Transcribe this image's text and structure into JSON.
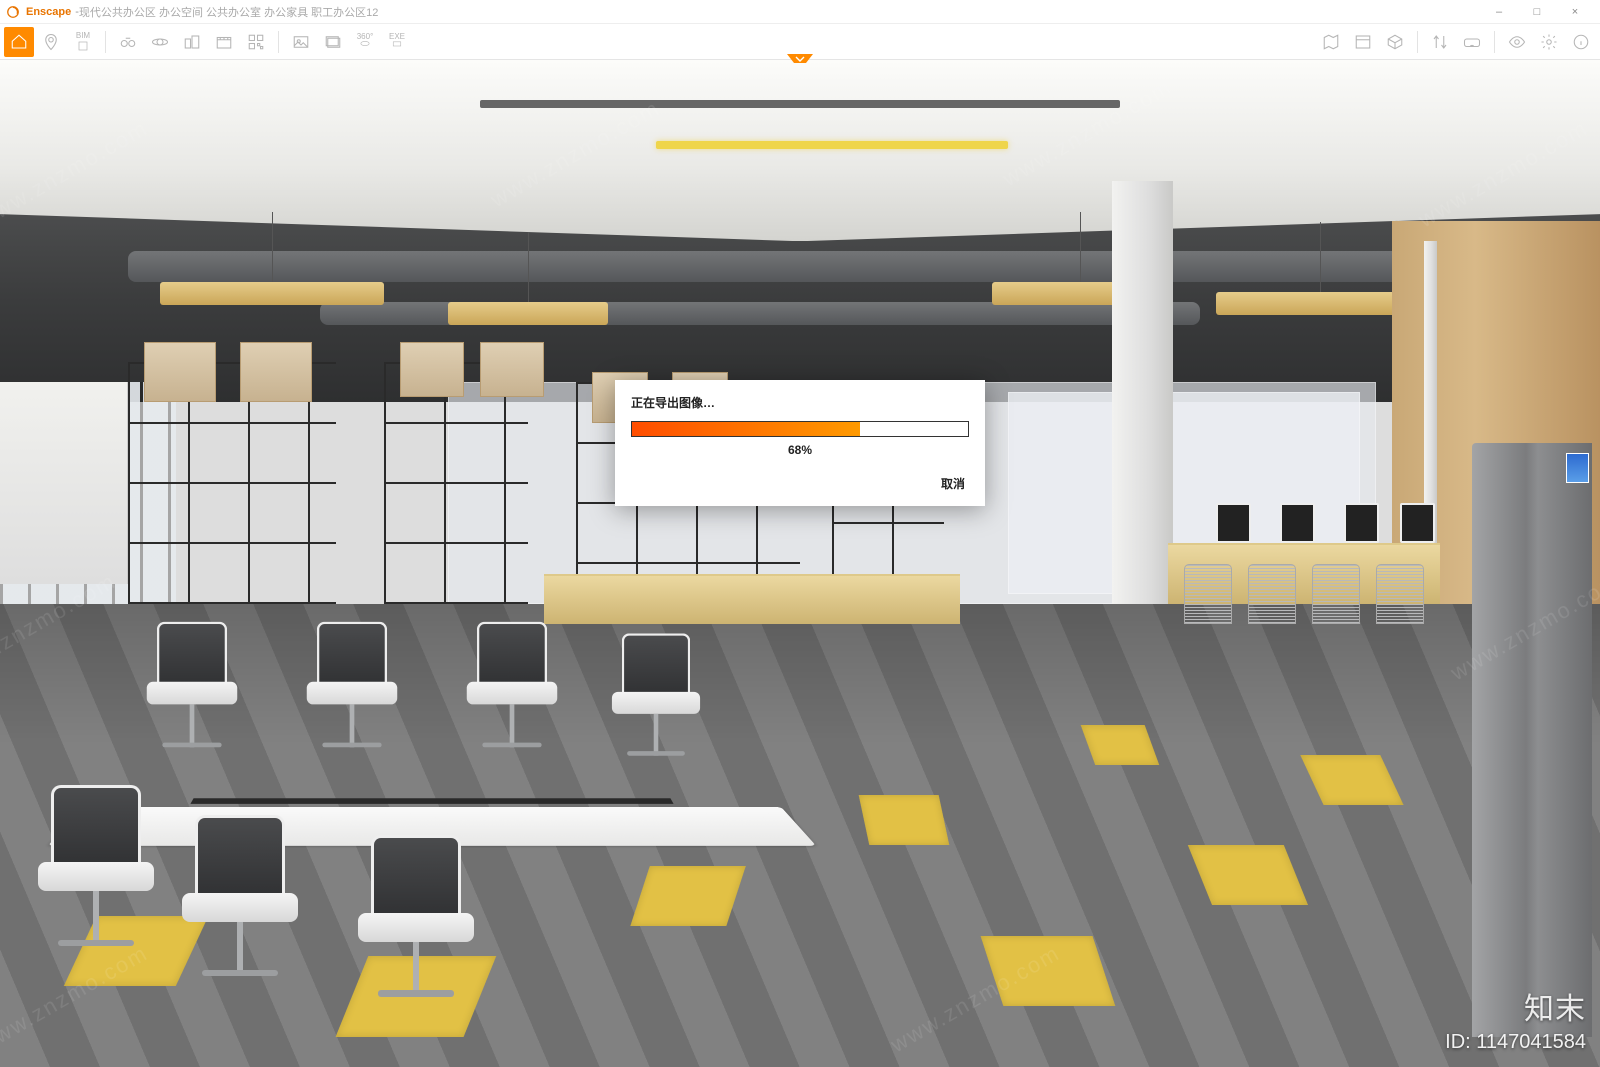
{
  "app": {
    "name": "Enscape",
    "document_title": "现代公共办公区 办公空间 公共办公室 办公家具 职工办公区12"
  },
  "window_controls": {
    "minimize": "–",
    "maximize": "□",
    "close": "×"
  },
  "toolbar_left": [
    {
      "name": "home",
      "active": true
    },
    {
      "name": "map-pin"
    },
    {
      "name": "bim",
      "label": "BIM"
    },
    {
      "name": "binoculars"
    },
    {
      "name": "orbit"
    },
    {
      "name": "buildings"
    },
    {
      "name": "clapper"
    },
    {
      "name": "qr"
    },
    {
      "name": "export-image"
    },
    {
      "name": "export-batch"
    },
    {
      "name": "export-360",
      "label": "360°"
    },
    {
      "name": "export-exe",
      "label": "EXE"
    }
  ],
  "toolbar_right": [
    {
      "name": "minimap"
    },
    {
      "name": "asset-library"
    },
    {
      "name": "cube-view"
    },
    {
      "name": "compare"
    },
    {
      "name": "vr"
    },
    {
      "name": "visibility"
    },
    {
      "name": "settings"
    },
    {
      "name": "info"
    }
  ],
  "dialog": {
    "title": "正在导出图像…",
    "percent_value": 68,
    "percent_label": "68%",
    "cancel": "取消"
  },
  "watermark": {
    "brand": "知末",
    "id_label": "ID: 1147041584",
    "repeat": "www.znzmo.com"
  },
  "colors": {
    "accent": "#ff8a00",
    "progress_start": "#ff4d00",
    "progress_end": "#ff9a00"
  }
}
